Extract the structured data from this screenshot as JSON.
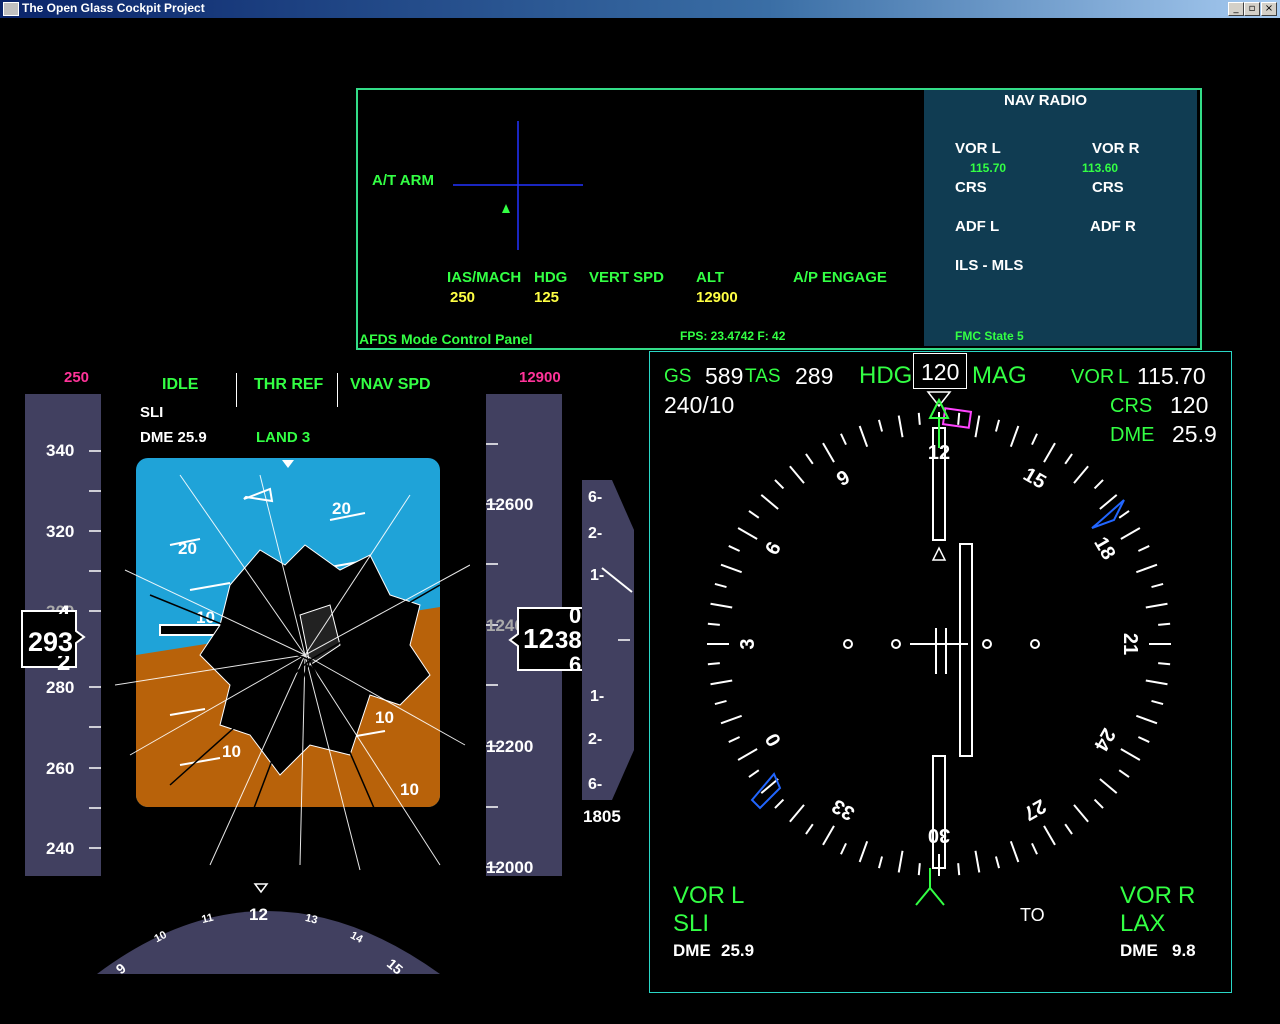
{
  "window": {
    "title": "The Open Glass Cockpit Project",
    "buttons": [
      "_",
      "▫",
      "×"
    ]
  },
  "mcp": {
    "at_arm": "A/T ARM",
    "fields": [
      {
        "label": "IAS/MACH",
        "value": "250"
      },
      {
        "label": "HDG",
        "value": "125"
      },
      {
        "label": "VERT SPD",
        "value": ""
      },
      {
        "label": "ALT",
        "value": "12900"
      },
      {
        "label": "A/P ENGAGE",
        "value": ""
      }
    ],
    "panel_name": "AFDS Mode Control Panel",
    "fps": "FPS: 23.4742 F: 42"
  },
  "nav_radio": {
    "title": "NAV RADIO",
    "vor_l": "VOR L",
    "vor_l_freq": "115.70",
    "vor_r": "VOR R",
    "vor_r_freq": "113.60",
    "crs_l": "CRS",
    "crs_r": "CRS",
    "adf_l": "ADF L",
    "adf_r": "ADF R",
    "ils": "ILS - MLS",
    "fmc_state": "FMC State 5"
  },
  "pfd": {
    "speed_bug": "250",
    "alt_bug": "12900",
    "fma": [
      "IDLE",
      "THR REF",
      "VNAV SPD"
    ],
    "sli": "SLI",
    "dme": "DME 25.9",
    "land": "LAND 3",
    "speed_ticks": [
      "340",
      "320",
      "300",
      "280",
      "260",
      "240"
    ],
    "speed_readout": "293",
    "speed_roll_up": "4",
    "speed_roll_down": "2",
    "alt_ticks": [
      "12600",
      "12400",
      "12200",
      "12000"
    ],
    "alt_readout_main": "12",
    "alt_readout_sub": "380",
    "alt_roll_up": "00",
    "alt_roll_down": "60",
    "vs_scale": [
      "6-",
      "2-",
      "1-",
      "1-",
      "2-",
      "6-"
    ],
    "vs_value": "1805",
    "pitch_labels": [
      "20",
      "20",
      "10",
      "10",
      "10",
      "10"
    ],
    "heading_labels": [
      "9",
      "10",
      "11",
      "12",
      "13",
      "14",
      "15"
    ],
    "colors": {
      "sky": "#1fa3d8",
      "ground": "#b8620a",
      "tape": "#414060"
    }
  },
  "nd": {
    "gs_label": "GS",
    "gs": "589",
    "tas_label": "TAS",
    "tas": "289",
    "hdg_label": "HDG",
    "hdg": "120",
    "mag": "MAG",
    "wind": "240/10",
    "vor_l_label": "VOR",
    "vor_l_side": "L",
    "vor_l_freq": "115.70",
    "crs_label": "CRS",
    "crs": "120",
    "dme_label": "DME",
    "dme": "25.9",
    "compass": [
      "12",
      "15",
      "18",
      "21",
      "24",
      "27",
      "30",
      "33",
      "0",
      "3",
      "6",
      "9"
    ],
    "bottom_left": {
      "label": "VOR",
      "side": "L",
      "ident": "SLI",
      "dme_label": "DME",
      "dme": "25.9"
    },
    "bottom_right": {
      "label": "VOR",
      "side": "R",
      "ident": "LAX",
      "dme_label": "DME",
      "dme": "9.8"
    },
    "to_from": "TO"
  }
}
